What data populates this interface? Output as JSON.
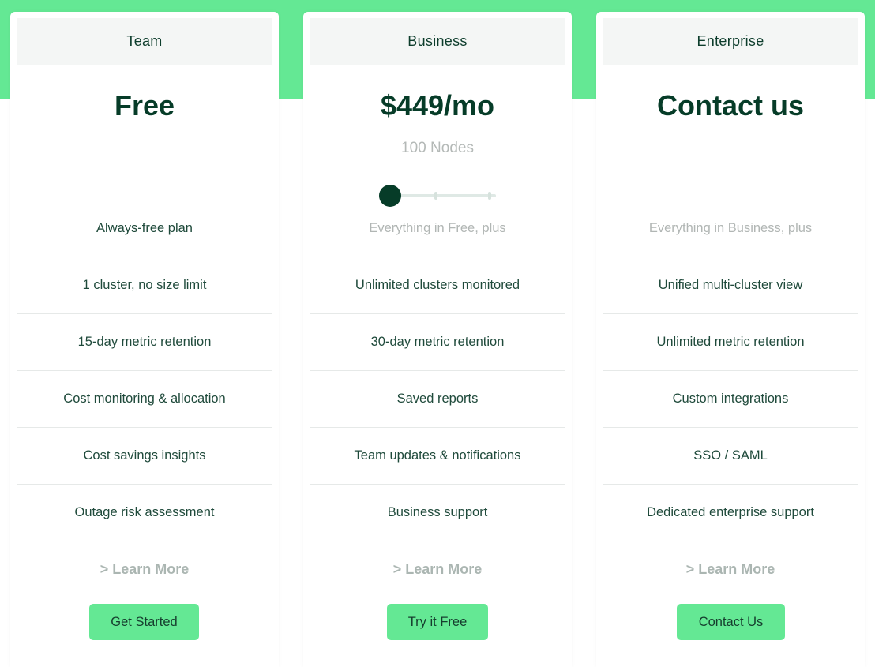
{
  "colors": {
    "brand_green": "#64e894",
    "dark_green": "#063c28",
    "muted": "#b1b6b4"
  },
  "plans": [
    {
      "name": "Team",
      "price": "Free",
      "features": [
        "Always-free plan",
        "1 cluster, no size limit",
        "15-day metric retention",
        "Cost monitoring & allocation",
        "Cost savings insights",
        "Outage risk assessment"
      ],
      "learn_more": "> Learn More",
      "cta": "Get Started"
    },
    {
      "name": "Business",
      "price": "$449/mo",
      "nodes_label": "100 Nodes",
      "slider": {
        "position": 0,
        "steps": 3
      },
      "features": [
        "Everything in Free, plus",
        "Unlimited clusters monitored",
        "30-day metric retention",
        "Saved reports",
        "Team updates & notifications",
        "Business support"
      ],
      "learn_more": "> Learn More",
      "cta": "Try it Free"
    },
    {
      "name": "Enterprise",
      "price": "Contact us",
      "features": [
        "Everything in Business, plus",
        "Unified multi-cluster view",
        "Unlimited metric retention",
        "Custom integrations",
        "SSO / SAML",
        "Dedicated enterprise support"
      ],
      "learn_more": "> Learn More",
      "cta": "Contact Us"
    }
  ]
}
